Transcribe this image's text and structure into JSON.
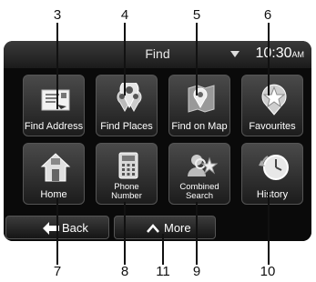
{
  "callouts": [
    "3",
    "4",
    "5",
    "6",
    "7",
    "8",
    "9",
    "10",
    "11"
  ],
  "header": {
    "title": "Find",
    "time": "10:30",
    "ampm": "AM"
  },
  "tiles": [
    {
      "label": "Find Address"
    },
    {
      "label": "Find Places"
    },
    {
      "label": "Find on Map"
    },
    {
      "label": "Favourites"
    },
    {
      "label": "Home"
    },
    {
      "label": "Phone\nNumber"
    },
    {
      "label": "Combined\nSearch"
    },
    {
      "label": "History"
    }
  ],
  "buttons": {
    "back": "Back",
    "more": "More"
  },
  "icons": [
    "address-card-icon",
    "places-pins-icon",
    "map-pin-icon",
    "star-pin-icon",
    "house-icon",
    "phone-icon",
    "combined-search-icon",
    "history-clock-icon",
    "back-arrow-icon",
    "up-arrow-icon"
  ]
}
